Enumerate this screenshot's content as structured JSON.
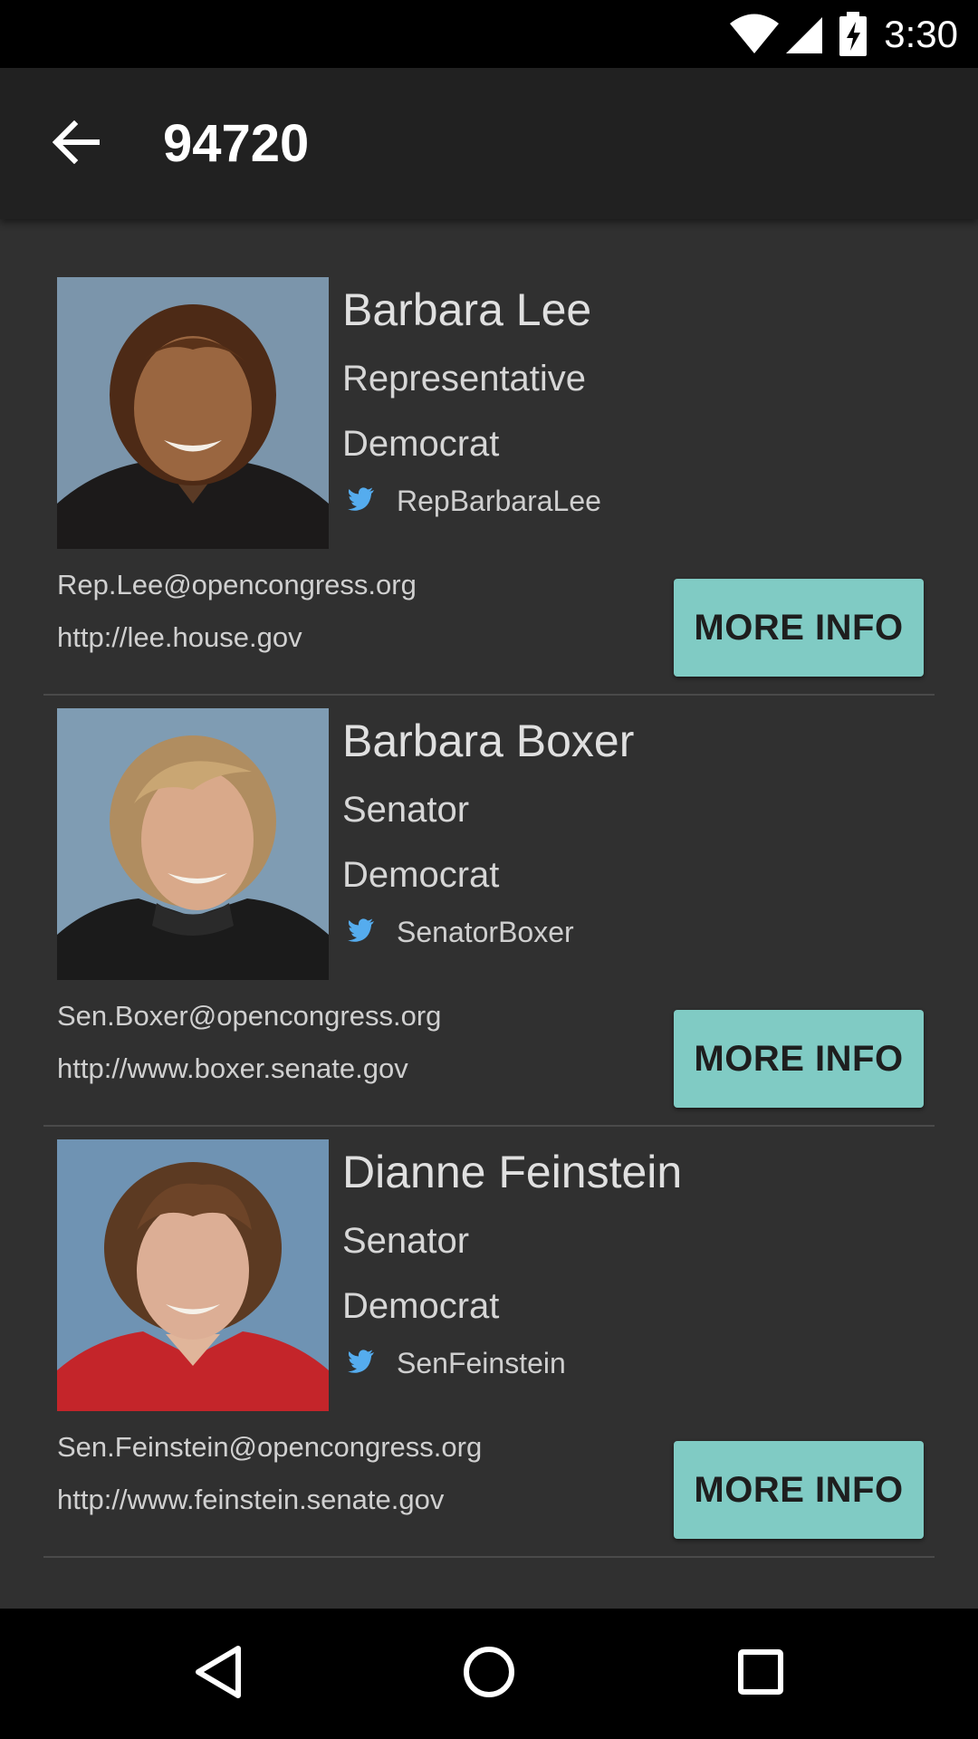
{
  "status_bar": {
    "time": "3:30",
    "icons": [
      "wifi-icon",
      "signal-icon",
      "battery-charging-icon"
    ]
  },
  "app_bar": {
    "back_icon": "arrow-back-icon",
    "title": "94720"
  },
  "colors": {
    "background": "#303030",
    "app_bar": "#212121",
    "accent_button": "#80cbc4",
    "twitter_blue": "#55acee",
    "divider": "#4a4a4a"
  },
  "representatives": [
    {
      "name": "Barbara Lee",
      "role": "Representative",
      "party": "Democrat",
      "twitter": "RepBarbaraLee",
      "email": "Rep.Lee@opencongress.org",
      "website": "http://lee.house.gov",
      "button_label": "MORE INFO"
    },
    {
      "name": "Barbara Boxer",
      "role": "Senator",
      "party": "Democrat",
      "twitter": "SenatorBoxer",
      "email": "Sen.Boxer@opencongress.org",
      "website": "http://www.boxer.senate.gov",
      "button_label": "MORE INFO"
    },
    {
      "name": "Dianne Feinstein",
      "role": "Senator",
      "party": "Democrat",
      "twitter": "SenFeinstein",
      "email": "Sen.Feinstein@opencongress.org",
      "website": "http://www.feinstein.senate.gov",
      "button_label": "MORE INFO"
    }
  ],
  "nav_bar": {
    "icons": [
      "back-triangle-icon",
      "home-circle-icon",
      "recents-square-icon"
    ]
  }
}
